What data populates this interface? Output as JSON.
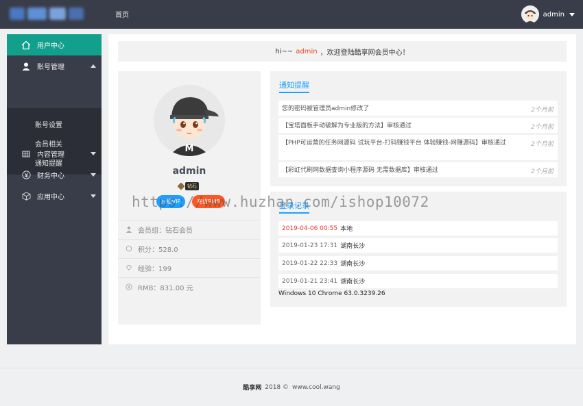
{
  "header": {
    "nav_home": "首页",
    "user_name": "admin",
    "logo_colors": [
      "#4a78c2",
      "#5f8fd6",
      "#7aa3de",
      "#4b6fb0"
    ]
  },
  "sidebar": {
    "items": [
      {
        "label": "用户中心",
        "icon": "home-icon"
      },
      {
        "label": "账号管理",
        "icon": "user-icon"
      },
      {
        "label": "内容管理",
        "icon": "grid-icon"
      },
      {
        "label": "财务中心",
        "icon": "yen-icon"
      },
      {
        "label": "应用中心",
        "icon": "box-icon"
      }
    ],
    "sub_items": [
      "账号设置",
      "会员相关",
      "通知提醒"
    ],
    "accent": "#12a08d"
  },
  "welcome": {
    "prefix": "hi~~",
    "name": "admin",
    "suffix": "，欢迎登陆酷享网会员中心！"
  },
  "profile": {
    "name": "admin",
    "badge": "钻石",
    "btn_upgrade": "升级VIP",
    "btn_recharge": "充值RMB",
    "info": [
      {
        "text": "会员组：钻石会员",
        "icon": "user-icon"
      },
      {
        "text": "积分：528.0",
        "icon": "circle-icon"
      },
      {
        "text": "经验：199",
        "icon": "diamond-icon"
      },
      {
        "text": "RMB：831.00 元",
        "icon": "yen-icon"
      }
    ]
  },
  "notices": {
    "title": "通知提醒",
    "items": [
      {
        "text": "您的密码被管理员admin修改了",
        "time": "2个月前"
      },
      {
        "text": "【宝塔面板手动破解为专业版的方法】审核通过",
        "time": "2个月前"
      },
      {
        "text": "【PHP可运营的任务网源码 试玩平台-打码赚钱平台 体验赚钱-网赚源码】审核通过",
        "time": "2个月前"
      },
      {
        "text": "【彩虹代刷网数据查询小程序源码 无需数据库】审核通过",
        "time": "2个月前"
      }
    ]
  },
  "logins": {
    "title": "登录记录",
    "items": [
      {
        "time": "2019-04-06 00:55",
        "place": "本地"
      },
      {
        "time": "2019-01-23 17:31",
        "place": "湖南长沙"
      },
      {
        "time": "2019-01-22 22:33",
        "place": "湖南长沙"
      },
      {
        "time": "2019-01-21 23:41",
        "place": "湖南长沙"
      }
    ],
    "device": "Windows 10 Chrome 63.0.3239.26"
  },
  "watermark": "https://www.huzhan.com/ishop10072",
  "footer": {
    "brand": "酷享网",
    "year": "2018 ©",
    "site": "www.cool.wang"
  }
}
